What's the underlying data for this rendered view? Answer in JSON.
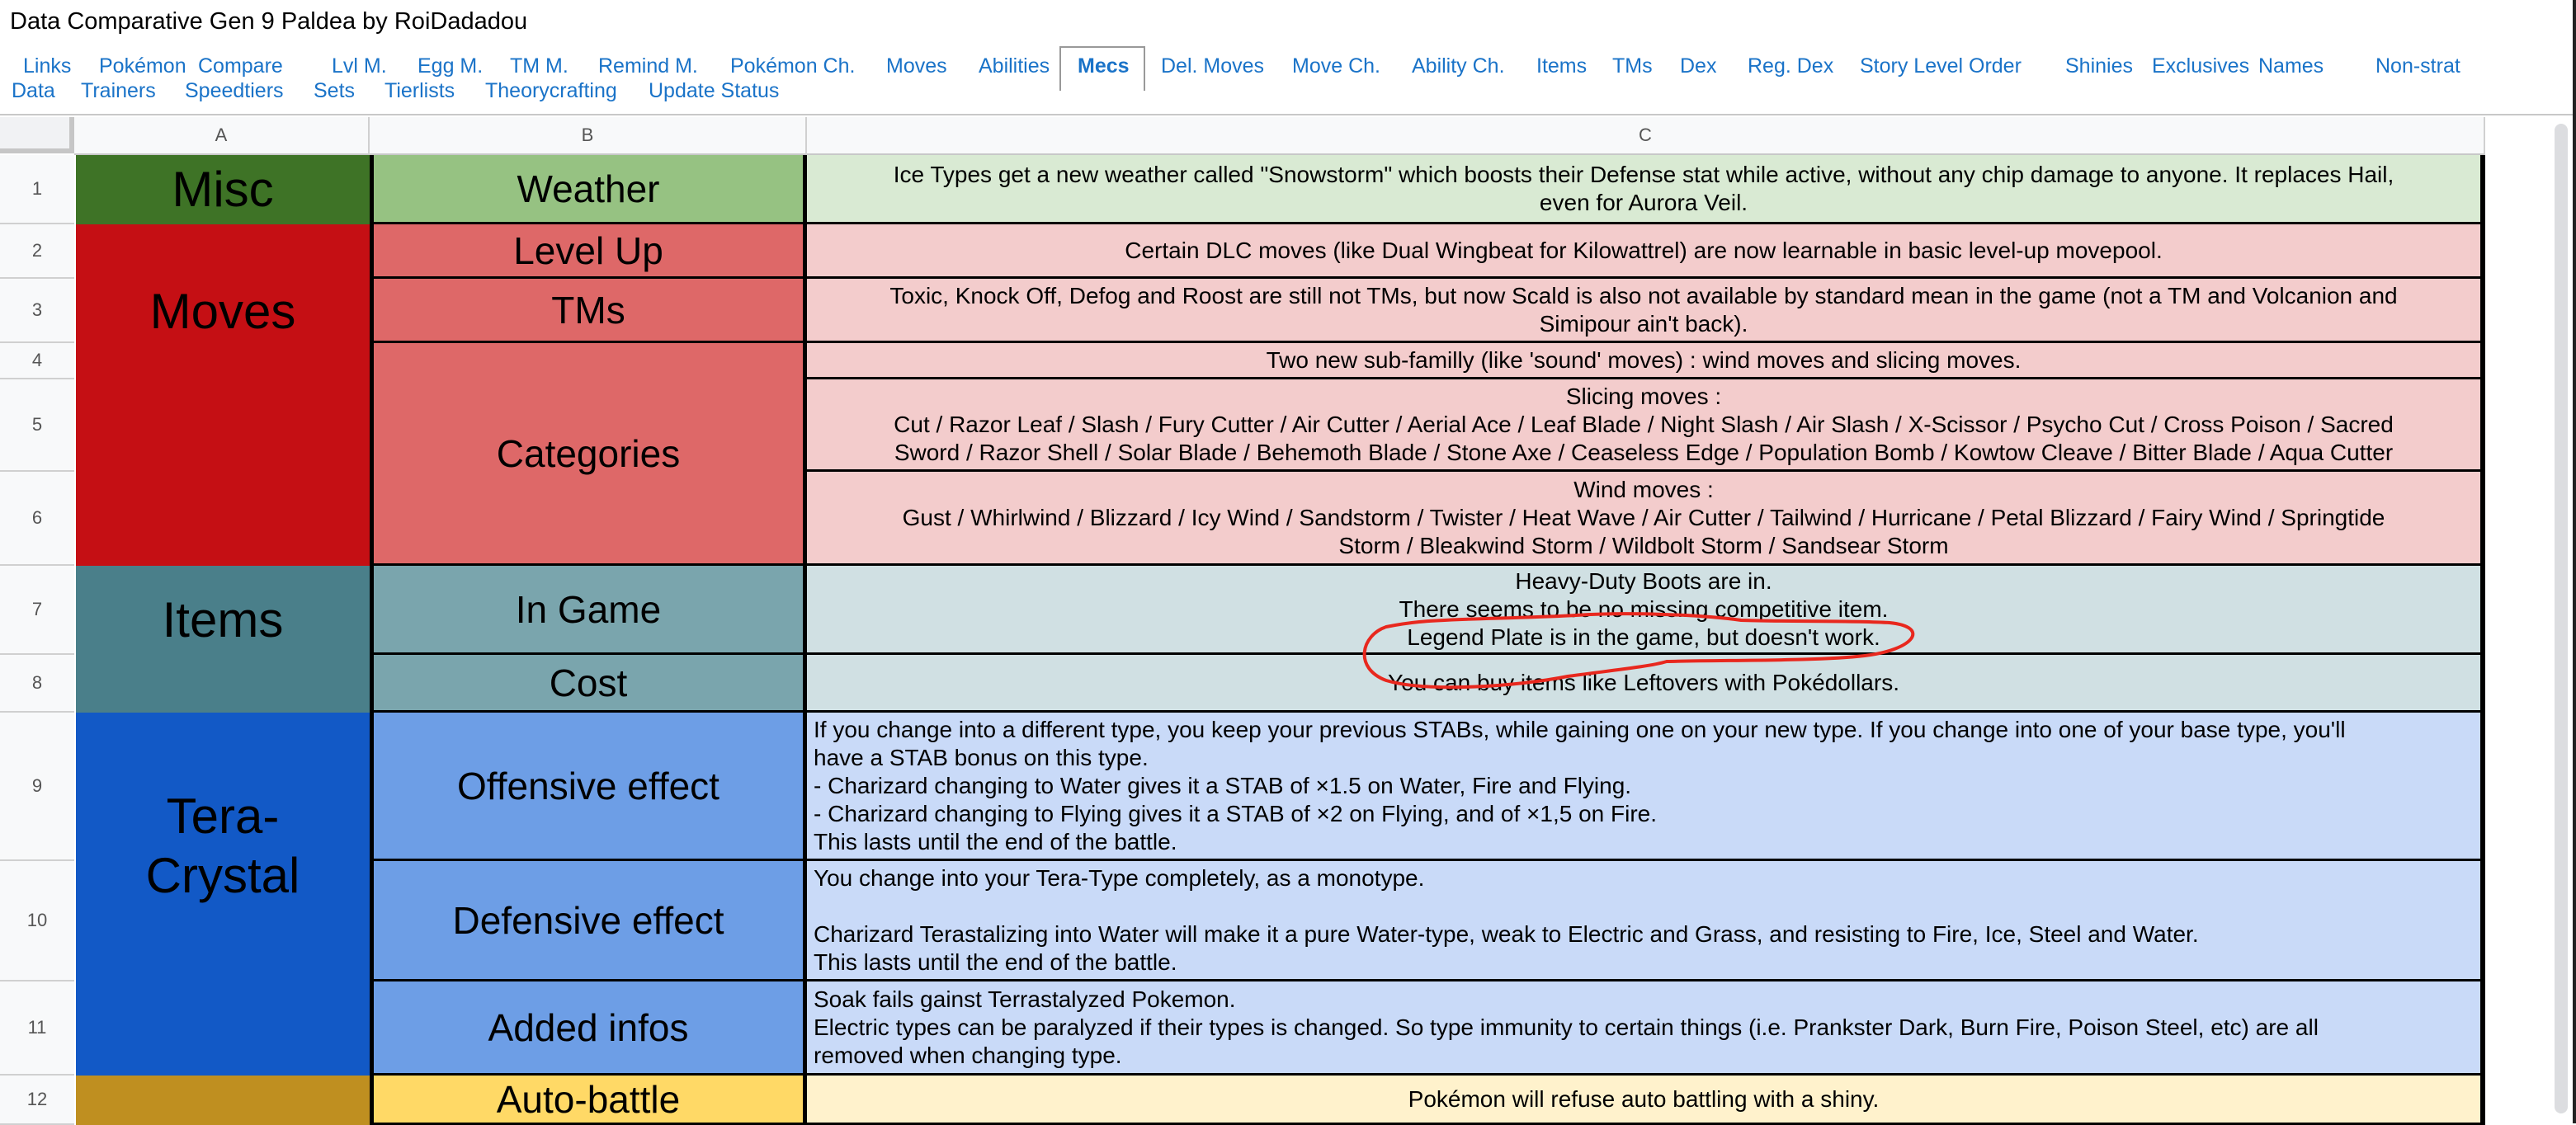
{
  "title": "Data Comparative Gen 9 Paldea by RoiDadadou",
  "nav": {
    "row1": [
      "Links",
      "Pokémon",
      "Compare",
      "Lvl M.",
      "Egg M.",
      "TM M.",
      "Remind M.",
      "Pokémon Ch.",
      "Moves",
      "Abilities",
      "Mecs",
      "Del. Moves",
      "Move Ch.",
      "Ability Ch.",
      "Items",
      "TMs",
      "Dex",
      "Reg. Dex",
      "Story Level Order",
      "Shinies",
      "Exclusives",
      "Names",
      "Non-strat"
    ],
    "row2": [
      "Data",
      "Trainers",
      "Speedtiers",
      "Sets",
      "Tierlists",
      "Theorycrafting",
      "Update Status"
    ],
    "active": "Mecs",
    "link_color": "#1a73c8"
  },
  "columns": [
    "A",
    "B",
    "C"
  ],
  "rows": [
    "1",
    "2",
    "3",
    "4",
    "5",
    "6",
    "7",
    "8",
    "9",
    "10",
    "11",
    "12"
  ],
  "categories": [
    {
      "label": "Misc",
      "color": "#3e7326"
    },
    {
      "label": "Moves",
      "color": "#c50f14"
    },
    {
      "label": "Items",
      "color": "#4a7f8a"
    },
    {
      "label": "Tera-\nCrystal",
      "color": "#1259c6"
    },
    {
      "label": "",
      "color": "#bf8f20"
    }
  ],
  "subcategories": [
    {
      "label": "Weather",
      "color": "#96c282"
    },
    {
      "label": "Level Up",
      "color": "#de6868"
    },
    {
      "label": "TMs",
      "color": "#de6868"
    },
    {
      "label": "Categories",
      "color": "#de6868"
    },
    {
      "label": "In Game",
      "color": "#7aa5ad"
    },
    {
      "label": "Cost",
      "color": "#7aa5ad"
    },
    {
      "label": "Offensive effect",
      "color": "#6d9ee6"
    },
    {
      "label": "Defensive effect",
      "color": "#6d9ee6"
    },
    {
      "label": "Added infos",
      "color": "#6d9ee6"
    },
    {
      "label": "Auto-battle",
      "color": "#ffd966"
    }
  ],
  "details": [
    {
      "color": "#d9ead3",
      "lines": [
        "Ice Types get a new weather called \"Snowstorm\" which boosts their Defense stat while active, without any chip damage to anyone. It replaces Hail,",
        "even for Aurora Veil."
      ]
    },
    {
      "color": "#f3cccc",
      "lines": [
        "Certain DLC moves (like Dual Wingbeat for Kilowattrel) are now learnable in basic level-up movepool."
      ]
    },
    {
      "color": "#f3cccc",
      "lines": [
        "Toxic, Knock Off, Defog and Roost are still not TMs, but now Scald is also not available by standard mean in the game (not a TM and Volcanion and",
        "Simipour ain't back)."
      ]
    },
    {
      "color": "#f3cccc",
      "lines": [
        "Two new sub-familly (like 'sound' moves) : wind moves and slicing moves."
      ]
    },
    {
      "color": "#f3cccc",
      "lines": [
        "Slicing moves :",
        "Cut / Razor Leaf / Slash / Fury Cutter / Air Cutter / Aerial Ace / Leaf Blade / Night Slash / Air Slash / X-Scissor / Psycho Cut / Cross Poison / Sacred",
        "Sword / Razor Shell / Solar Blade / Behemoth Blade / Stone Axe / Ceaseless Edge / Population Bomb / Kowtow Cleave / Bitter Blade / Aqua Cutter"
      ]
    },
    {
      "color": "#f3cccc",
      "lines": [
        "Wind moves :",
        "Gust / Whirlwind / Blizzard / Icy Wind / Sandstorm / Twister / Heat Wave / Air Cutter / Tailwind / Hurricane / Petal Blizzard / Fairy Wind / Springtide",
        "Storm / Bleakwind Storm / Wildbolt Storm / Sandsear Storm"
      ]
    },
    {
      "color": "#d0e0e3",
      "lines": [
        "Heavy-Duty Boots are in.",
        "There seems to be no missing competitive item.",
        "Legend Plate is in the game, but doesn't work."
      ]
    },
    {
      "color": "#d0e0e3",
      "lines": [
        "You can buy items like Leftovers with Pokédollars."
      ]
    },
    {
      "color": "#c9daf8",
      "lines": [
        "If you change into a different type, you keep your previous STABs, while gaining one on your new type. If you change into one of your base type, you'll",
        "have a STAB bonus on this type.",
        "- Charizard changing to Water gives it a STAB of ×1.5 on Water, Fire and Flying.",
        "- Charizard changing to Flying gives it a STAB of ×2 on Flying, and of ×1,5 on Fire.",
        "This lasts until the end of the battle."
      ]
    },
    {
      "color": "#c9daf8",
      "lines": [
        "You change into your Tera-Type completely, as a monotype.",
        "",
        "Charizard Terastalizing into Water will make it a pure Water-type, weak to Electric and Grass, and resisting to Fire, Ice, Steel and Water.",
        "This lasts until the end of the battle."
      ]
    },
    {
      "color": "#c9daf8",
      "lines": [
        "Soak fails gainst Terrastalyzed Pokemon.",
        "Electric types can be paralyzed if their types is changed. So type immunity to certain things (i.e. Prankster Dark, Burn Fire, Poison Steel, etc) are all",
        "removed when changing type."
      ]
    },
    {
      "color": "#fff2cc",
      "lines": [
        "Pokémon will refuse auto battling with a shiny."
      ]
    }
  ],
  "annotation": {
    "type": "red-hand-drawn-circle",
    "target": "Legend Plate is in the game, but doesn't work.",
    "color": "#e8281e"
  }
}
